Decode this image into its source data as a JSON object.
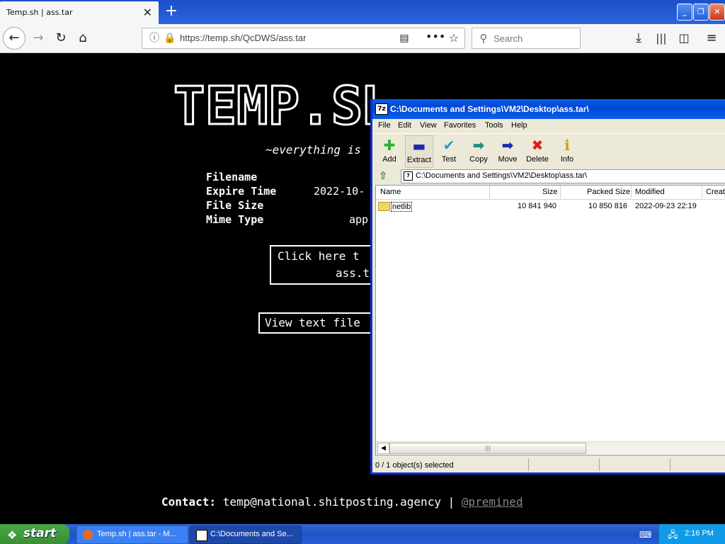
{
  "browser": {
    "tab_title": "Temp.sh | ass.tar",
    "url": "https://temp.sh/QcDWS/ass.tar",
    "search_placeholder": "Search"
  },
  "page": {
    "logo_text": "TEMP.SH",
    "tagline": "~everything is",
    "info_labels": [
      "Filename",
      "Expire Time",
      "File Size",
      "Mime Type"
    ],
    "expire_value": "2022-10-",
    "mime_value": "app",
    "download_line1": "Click here t",
    "download_line2": "ass.t",
    "view_text": "View text file",
    "contact_label": "Contact:",
    "contact_email": "temp@national.shitposting.agency",
    "contact_sep": "|",
    "contact_link": "@premined"
  },
  "zip": {
    "title": "C:\\Documents and Settings\\VM2\\Desktop\\ass.tar\\",
    "menu": [
      "File",
      "Edit",
      "View",
      "Favorites",
      "Tools",
      "Help"
    ],
    "toolbar": [
      "Add",
      "Extract",
      "Test",
      "Copy",
      "Move",
      "Delete",
      "Info"
    ],
    "address": "C:\\Documents and Settings\\VM2\\Desktop\\ass.tar\\",
    "columns": [
      "Name",
      "Size",
      "Packed Size",
      "Modified",
      "Create"
    ],
    "rows": [
      {
        "name": "netlib",
        "size": "10 841 940",
        "packed": "10 850 816",
        "modified": "2022-09-23 22:19"
      }
    ],
    "status": "0 / 1 object(s) selected"
  },
  "taskbar": {
    "start_label": "start",
    "task1": "Temp.sh | ass.tar - M...",
    "task2": "C:\\Documents and Se...",
    "clock": "2:16 PM"
  },
  "colors": {
    "title_blue": "#0a5ee8",
    "taskbar_blue": "#245ddb",
    "start_green": "#3a8f34"
  }
}
